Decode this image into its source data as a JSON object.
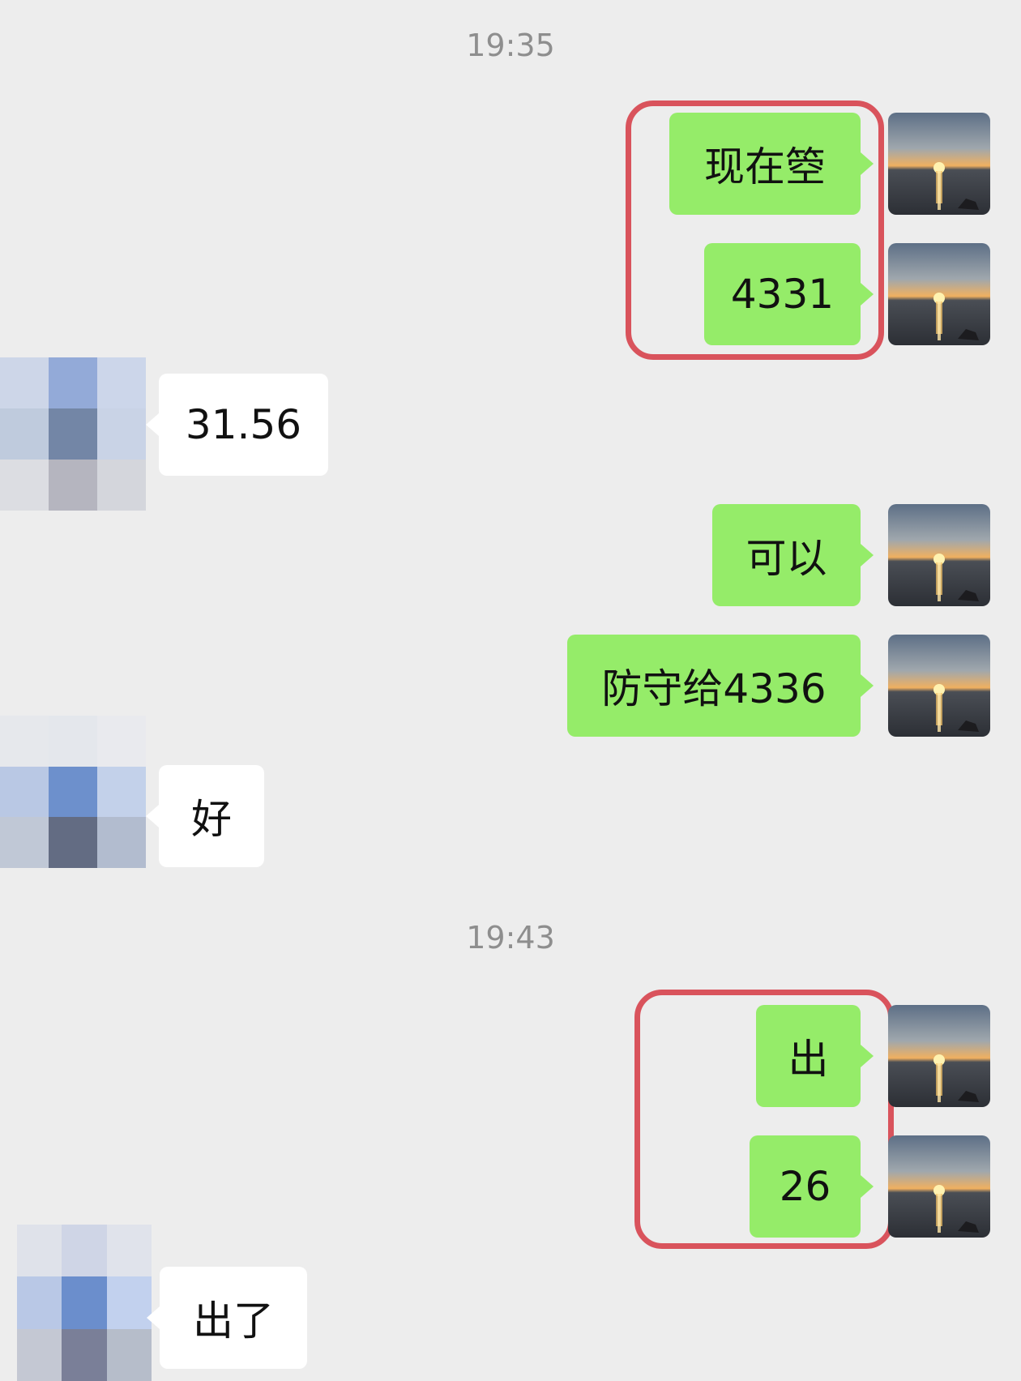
{
  "chat": {
    "timestamps": [
      "19:35",
      "19:43"
    ],
    "messages": [
      {
        "side": "sent",
        "text": "现在箜"
      },
      {
        "side": "sent",
        "text": "4331"
      },
      {
        "side": "received",
        "text": "31.56"
      },
      {
        "side": "sent",
        "text": "可以"
      },
      {
        "side": "sent",
        "text": "防守给4336"
      },
      {
        "side": "received",
        "text": "好"
      },
      {
        "side": "sent",
        "text": "出"
      },
      {
        "side": "sent",
        "text": "26"
      },
      {
        "side": "received",
        "text": "出了"
      }
    ]
  },
  "colors": {
    "background": "#ededed",
    "sent_bubble": "#95ec69",
    "received_bubble": "#ffffff",
    "timestamp_text": "#8e8e8e",
    "highlight_box": "#d9535c"
  },
  "icons": {
    "self_avatar": "sunset-over-sea-avatar",
    "contact_avatar": "pixelated-avatar"
  }
}
